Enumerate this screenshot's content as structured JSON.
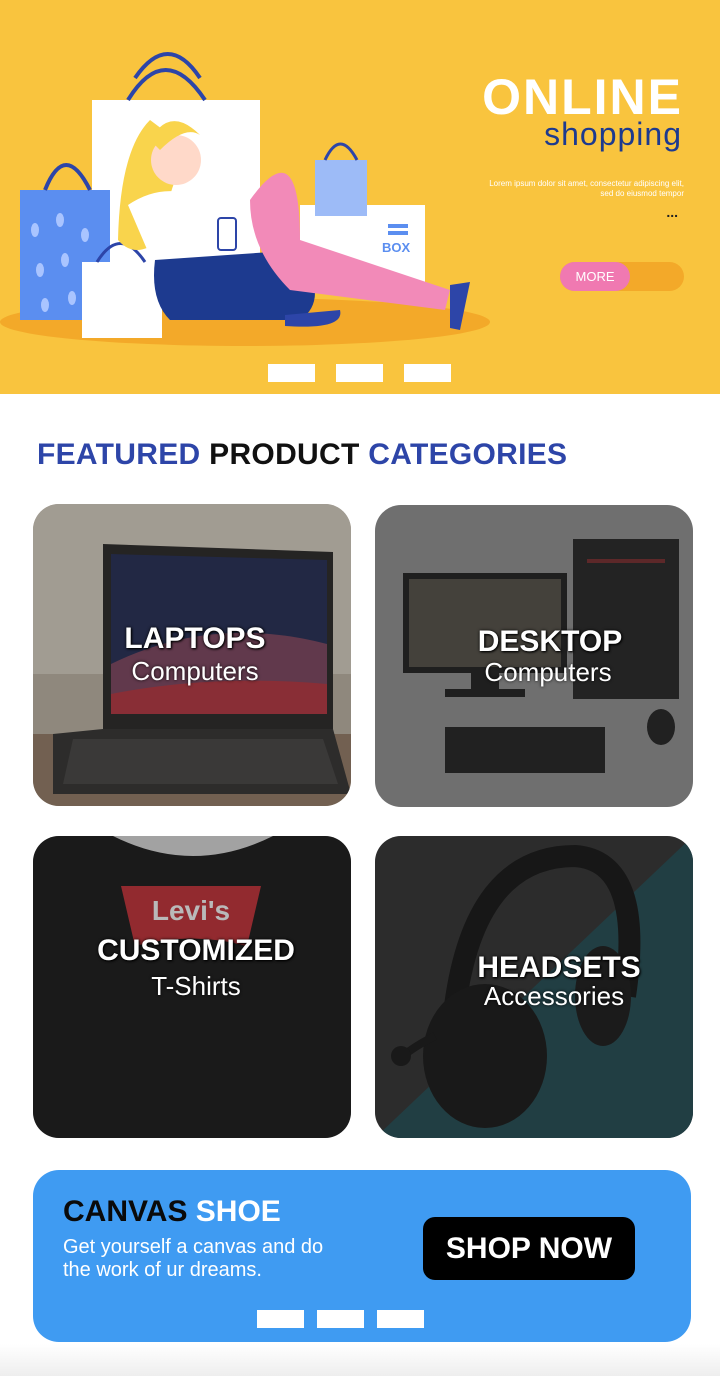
{
  "hero": {
    "title_line1": "ONLINE",
    "title_line2": "shopping",
    "lorem": "Lorem ipsum dolor sit amet, consectetur adipiscing elit, sed do eiusmod tempor",
    "dots": "...",
    "more_label": "MORE",
    "box_label": "BOX",
    "slides": 3
  },
  "section": {
    "word1": "FEATURED",
    "word2": "PRODUCT",
    "word3": "CATEGORIES"
  },
  "categories": [
    {
      "title": "LAPTOPS",
      "subtitle": "Computers"
    },
    {
      "title": "DESKTOP",
      "subtitle": "Computers"
    },
    {
      "title": "CUSTOMIZED",
      "subtitle": "T-Shirts",
      "shirt_brand": "Levi's"
    },
    {
      "title": "HEADSETS",
      "subtitle": "Accessories"
    }
  ],
  "promo": {
    "title_part1": "CANVAS",
    "title_part2": "SHOE",
    "text": "Get yourself a canvas and do the work of ur dreams.",
    "button_label": "SHOP NOW",
    "slides": 3
  },
  "colors": {
    "hero_bg": "#f9c43e",
    "accent_blue": "#2d45a8",
    "promo_bg": "#3f9bf2",
    "more_pink": "#f079b1"
  }
}
